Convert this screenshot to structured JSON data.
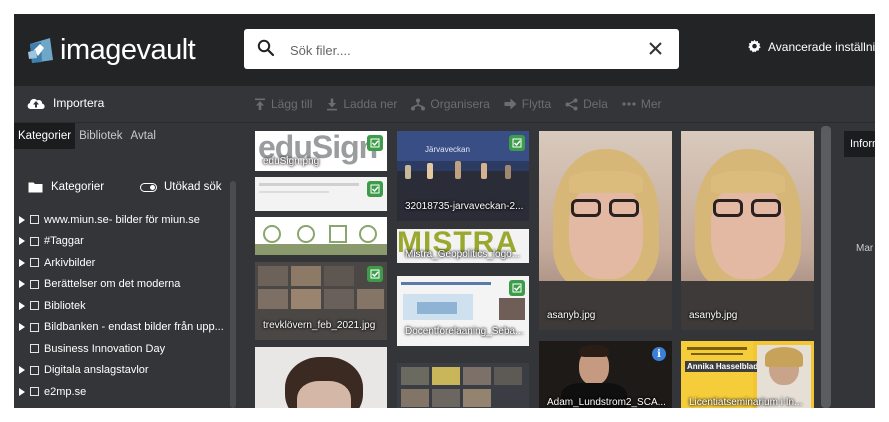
{
  "app": {
    "logo_text": "imagevault"
  },
  "search": {
    "placeholder": "Sök filer...."
  },
  "header": {
    "advanced_settings": "Avancerade inställningar"
  },
  "toolbar": {
    "import": "Importera",
    "actions": [
      {
        "label": "Lägg till",
        "icon": "upload-tray-icon"
      },
      {
        "label": "Ladda ner",
        "icon": "download-tray-icon"
      },
      {
        "label": "Organisera",
        "icon": "organize-icon"
      },
      {
        "label": "Flytta",
        "icon": "arrow-right-icon"
      },
      {
        "label": "Dela",
        "icon": "share-icon"
      },
      {
        "label": "Mer",
        "icon": "more-dots-icon"
      }
    ]
  },
  "left": {
    "tabs": [
      "Kategorier",
      "Bibliotek",
      "Avtal"
    ],
    "active_tab": "Kategorier",
    "categories_label": "Kategorier",
    "extended_search": "Utökad sök",
    "tree": [
      {
        "label": "www.miun.se- bilder för miun.se",
        "expandable": true
      },
      {
        "label": "#Taggar",
        "expandable": true
      },
      {
        "label": "Arkivbilder",
        "expandable": true
      },
      {
        "label": "Berättelser om det moderna",
        "expandable": true
      },
      {
        "label": "Bibliotek",
        "expandable": true
      },
      {
        "label": "Bildbanken - endast bilder från upp...",
        "expandable": true
      },
      {
        "label": "Business Innovation Day",
        "expandable": false
      },
      {
        "label": "Digitala anslagstavlor",
        "expandable": true
      },
      {
        "label": "e2mp.se",
        "expandable": true
      }
    ]
  },
  "tiles": [
    {
      "caption": "eduSign.png",
      "logo_text": "eduSign",
      "badge": "check"
    },
    {
      "caption": "",
      "badge": "check"
    },
    {
      "caption": ""
    },
    {
      "caption": "trevklövern_feb_2021.jpg",
      "badge": "check"
    },
    {
      "caption": ""
    },
    {
      "caption": "32018735-jarvaveckan-2...",
      "sign_text": "Järvaveckan",
      "badge": "check"
    },
    {
      "caption": "Mistra_Geopolitics_logo...",
      "logo_text": "MISTRA"
    },
    {
      "caption": "Docentforelaaning_Seba...",
      "badge": "check"
    },
    {
      "caption": ""
    },
    {
      "caption": "asanyb.jpg"
    },
    {
      "caption": "Adam_Lundstrom2_SCA...",
      "badge": "info"
    },
    {
      "caption": "asanyb.jpg"
    },
    {
      "caption": "Licentiatseminarium i In...",
      "poster_name": "Annika Hasselblad"
    }
  ],
  "right": {
    "tab": "Information",
    "label": "Mar"
  },
  "colors": {
    "topbar": "#222426",
    "panel": "#333538",
    "check_badge": "#3d9c4a",
    "info_badge": "#3b7fd6"
  }
}
